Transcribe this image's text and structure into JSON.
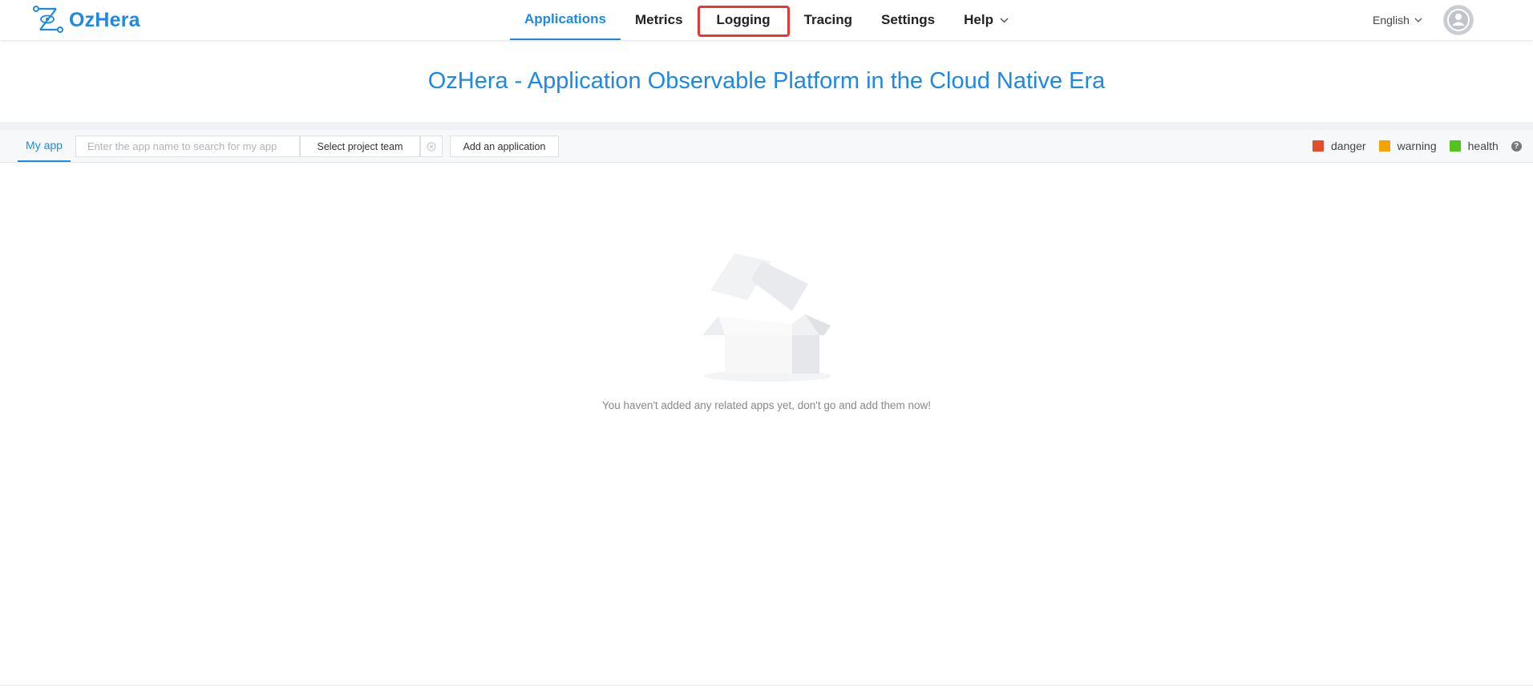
{
  "brand": {
    "name": "OzHera",
    "color": "#1e88e5"
  },
  "nav": {
    "items": [
      {
        "label": "Applications",
        "active": true
      },
      {
        "label": "Metrics"
      },
      {
        "label": "Logging",
        "highlighted": true
      },
      {
        "label": "Tracing"
      },
      {
        "label": "Settings"
      },
      {
        "label": "Help",
        "dropdown": true
      }
    ]
  },
  "header": {
    "language": "English"
  },
  "hero": {
    "title": "OzHera - Application Observable Platform in the Cloud Native Era"
  },
  "toolbar": {
    "tab_label": "My app",
    "search_placeholder": "Enter the app name to search for my app",
    "select_team_label": "Select project team",
    "add_app_label": "Add an application"
  },
  "legend": {
    "items": [
      {
        "label": "danger",
        "color": "#e24d2a"
      },
      {
        "label": "warning",
        "color": "#f5a300"
      },
      {
        "label": "health",
        "color": "#52c41a"
      }
    ]
  },
  "empty": {
    "message": "You haven't added any related apps yet, don't go and add them now!"
  }
}
